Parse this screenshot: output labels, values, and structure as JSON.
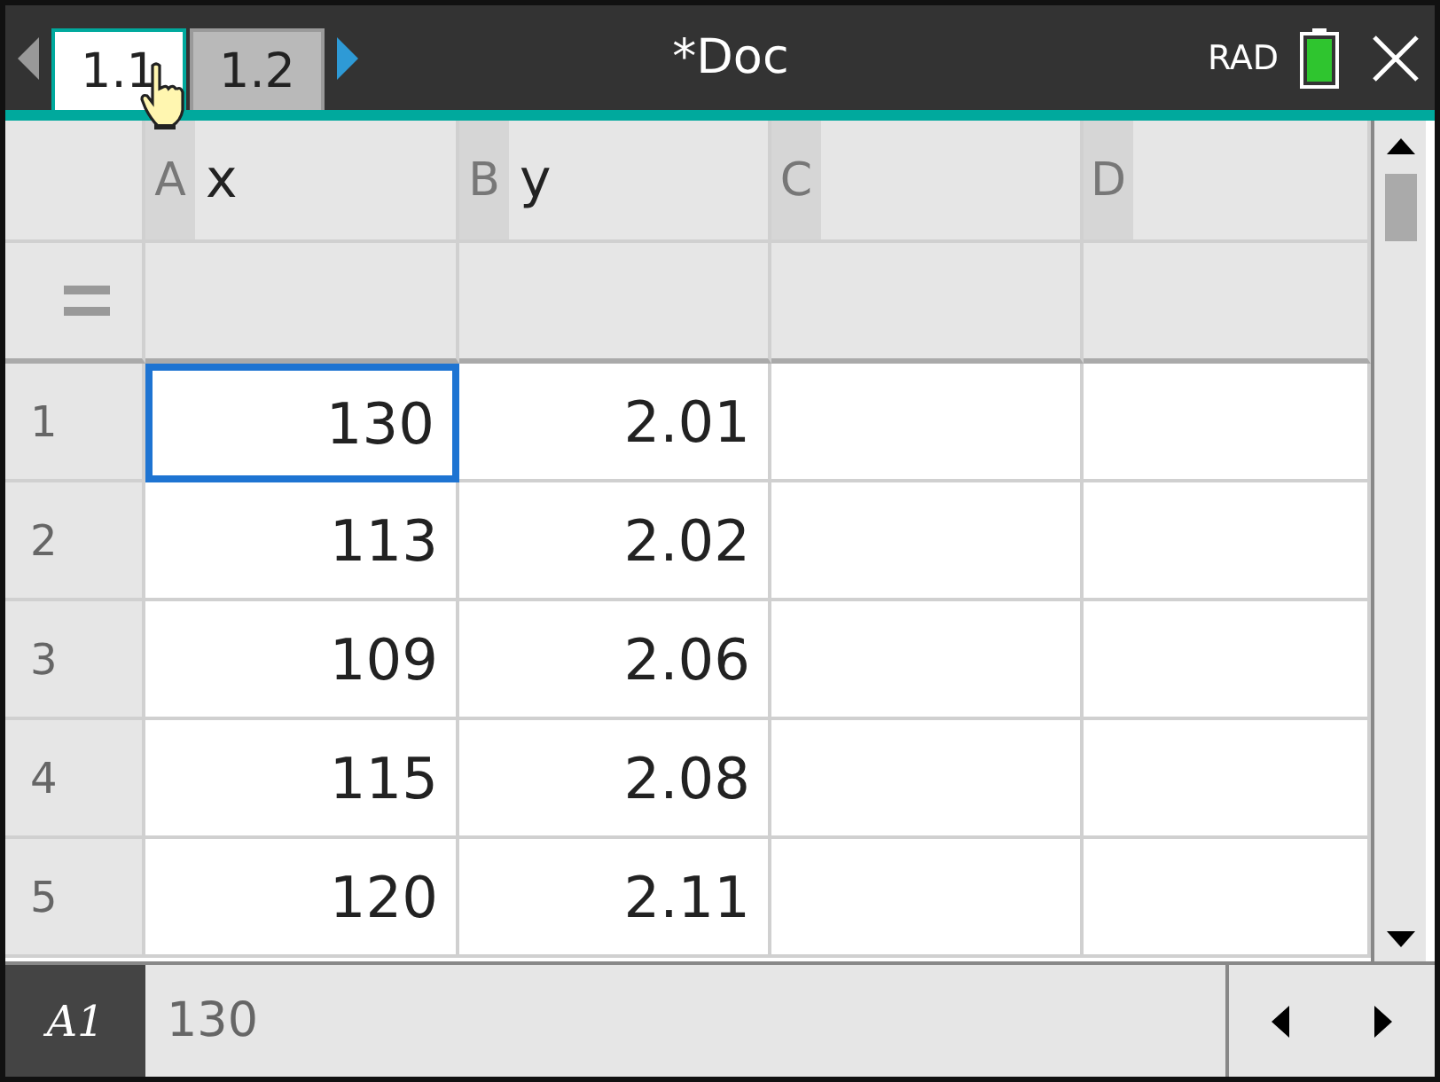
{
  "tabs": [
    {
      "label": "1.1",
      "selected": true
    },
    {
      "label": "1.2",
      "selected": false
    }
  ],
  "title": "*Doc",
  "angle_mode": "RAD",
  "columns": [
    {
      "letter": "A",
      "name": "x"
    },
    {
      "letter": "B",
      "name": "y"
    },
    {
      "letter": "C"
    },
    {
      "letter": "D"
    }
  ],
  "rows": [
    {
      "number": "1",
      "cells": [
        {
          "value": "130",
          "selected": true
        },
        {
          "value": "2.01",
          "selected": false
        }
      ]
    },
    {
      "number": "2",
      "cells": [
        {
          "value": "113",
          "selected": false
        },
        {
          "value": "2.02",
          "selected": false
        }
      ]
    },
    {
      "number": "3",
      "cells": [
        {
          "value": "109",
          "selected": false
        },
        {
          "value": "2.06",
          "selected": false
        }
      ]
    },
    {
      "number": "4",
      "cells": [
        {
          "value": "115",
          "selected": false
        },
        {
          "value": "2.08",
          "selected": false
        }
      ]
    },
    {
      "number": "5",
      "cells": [
        {
          "value": "120",
          "selected": false
        },
        {
          "value": "2.11",
          "selected": false
        }
      ]
    }
  ],
  "status_bar": {
    "cell_ref": "A1",
    "value": "130"
  }
}
